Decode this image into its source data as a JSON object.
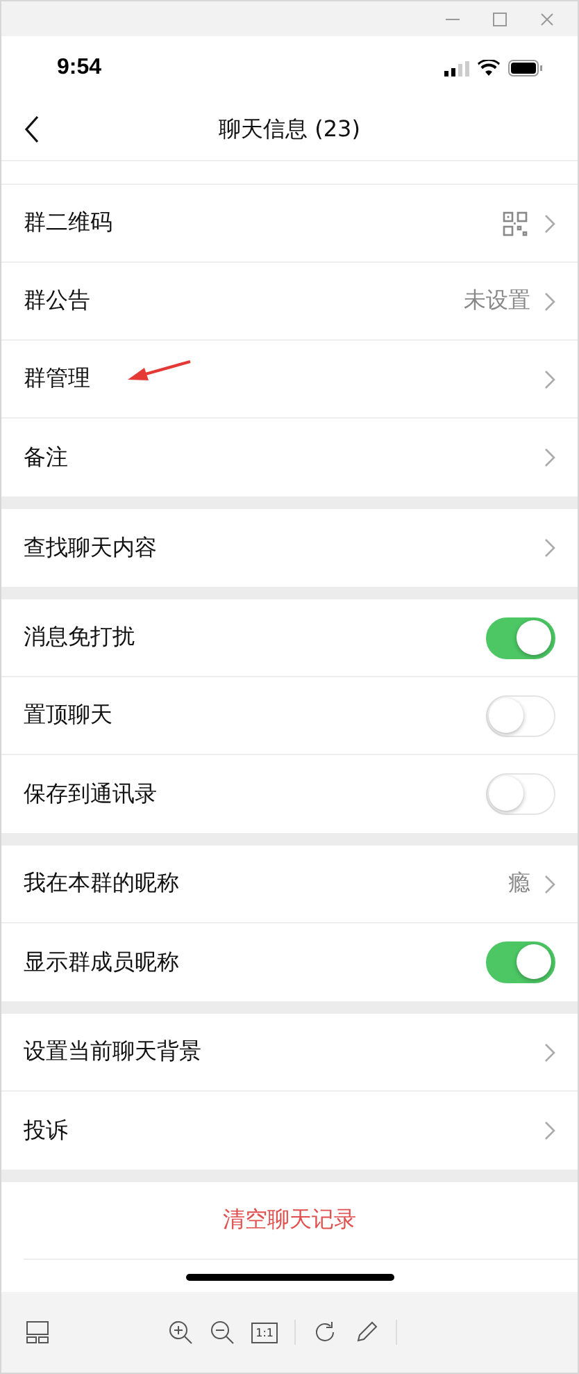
{
  "status_bar": {
    "time": "9:54"
  },
  "nav": {
    "title": "聊天信息 (23)"
  },
  "sections": [
    {
      "rows": [
        {
          "kind": "qr_link",
          "label": "群二维码"
        },
        {
          "kind": "link",
          "label": "群公告",
          "value": "未设置"
        },
        {
          "kind": "link",
          "label": "群管理",
          "annotated": true
        },
        {
          "kind": "link",
          "label": "备注"
        }
      ]
    },
    {
      "rows": [
        {
          "kind": "link",
          "label": "查找聊天内容"
        }
      ]
    },
    {
      "rows": [
        {
          "kind": "toggle",
          "label": "消息免打扰",
          "on": true
        },
        {
          "kind": "toggle",
          "label": "置顶聊天",
          "on": false
        },
        {
          "kind": "toggle",
          "label": "保存到通讯录",
          "on": false
        }
      ]
    },
    {
      "rows": [
        {
          "kind": "link",
          "label": "我在本群的昵称",
          "value": "瘾"
        },
        {
          "kind": "toggle",
          "label": "显示群成员昵称",
          "on": true
        }
      ]
    },
    {
      "rows": [
        {
          "kind": "link",
          "label": "设置当前聊天背景"
        },
        {
          "kind": "link",
          "label": "投诉"
        }
      ]
    }
  ],
  "danger_action": "清空聊天记录",
  "viewer_toolbar": {
    "actual_size": "1:1"
  }
}
